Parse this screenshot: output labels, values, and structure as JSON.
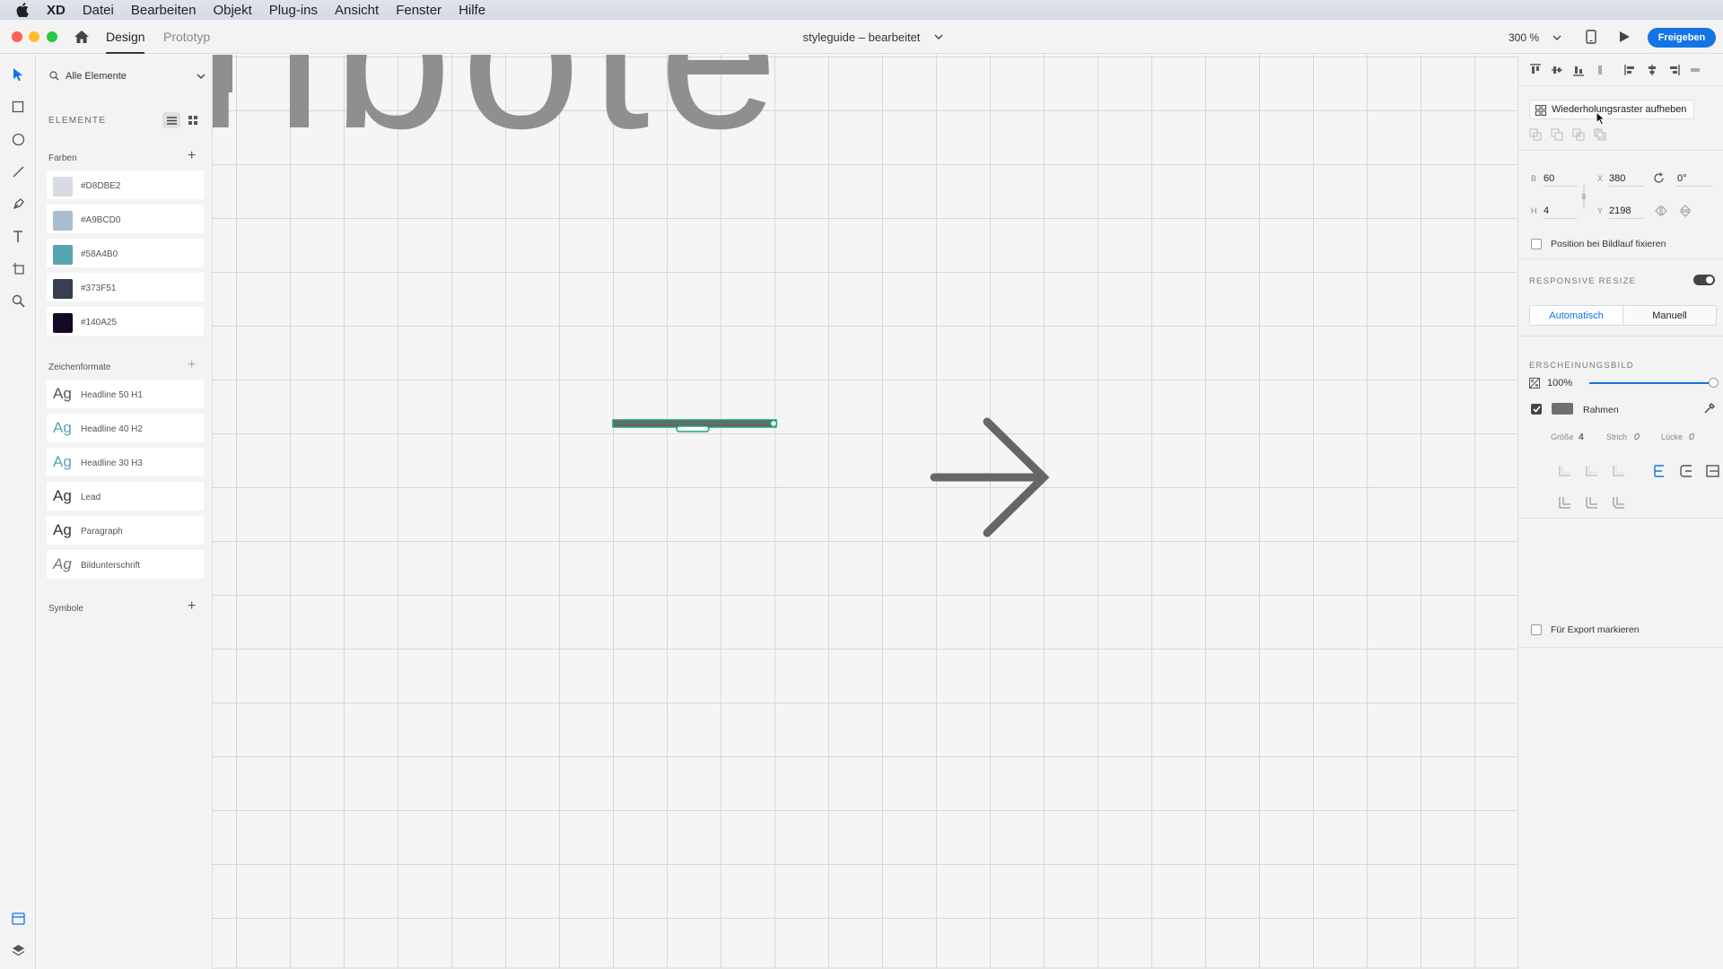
{
  "menubar": {
    "app_name": "XD",
    "items": [
      "Datei",
      "Bearbeiten",
      "Objekt",
      "Plug-ins",
      "Ansicht",
      "Fenster",
      "Hilfe"
    ]
  },
  "titlebar": {
    "tab_design": "Design",
    "tab_prototype": "Prototyp",
    "doc_title": "styleguide – bearbeitet",
    "zoom": "300 %",
    "share_label": "Freigeben"
  },
  "assets": {
    "search_placeholder": "Alle Elemente",
    "title": "ELEMENTE",
    "colors_title": "Farben",
    "colors": [
      {
        "label": "#D8DBE2",
        "hex": "#D8DBE2"
      },
      {
        "label": "#A9BCD0",
        "hex": "#A9BCD0"
      },
      {
        "label": "#58A4B0",
        "hex": "#58A4B0"
      },
      {
        "label": "#373F51",
        "hex": "#373F51"
      },
      {
        "label": "#140A25",
        "hex": "#140A25"
      }
    ],
    "char_styles_title": "Zeichenformate",
    "char_styles": [
      {
        "sample": "Ag",
        "label": "Headline 50 H1",
        "color": "#555555"
      },
      {
        "sample": "Ag",
        "label": "Headline 40 H2",
        "color": "#58A4B0"
      },
      {
        "sample": "Ag",
        "label": "Headline 30 H3",
        "color": "#58A4B0"
      },
      {
        "sample": "Ag",
        "label": "Lead",
        "color": "#333333"
      },
      {
        "sample": "Ag",
        "label": "Paragraph",
        "color": "#333333"
      },
      {
        "sample": "Ag",
        "label": "Bildunterschrift",
        "color": "#777777"
      }
    ],
    "symbols_title": "Symbole"
  },
  "inspector": {
    "repeat_grid_label": "Wiederholungsraster aufheben",
    "w_label": "B",
    "w_value": "60",
    "h_label": "H",
    "h_value": "4",
    "x_label": "X",
    "x_value": "380",
    "y_label": "Y",
    "y_value": "2198",
    "rotation": "0°",
    "fix_position_label": "Position bei Bildlauf fixieren",
    "responsive_title": "RESPONSIVE RESIZE",
    "responsive_on": true,
    "seg_auto": "Automatisch",
    "seg_manual": "Manuell",
    "appearance_title": "ERSCHEINUNGSBILD",
    "opacity": "100%",
    "border_label": "Rahmen",
    "border_color": "#707070",
    "size_label": "Größe",
    "size_value": "4",
    "dash_label": "Strich",
    "dash_value": "0",
    "gap_label": "Lücke",
    "gap_value": "0",
    "export_label": "Für Export markieren"
  },
  "canvas": {
    "headline_fragment": "ribote",
    "selection_color": "#1aa36e",
    "arrow_color": "#666666"
  }
}
